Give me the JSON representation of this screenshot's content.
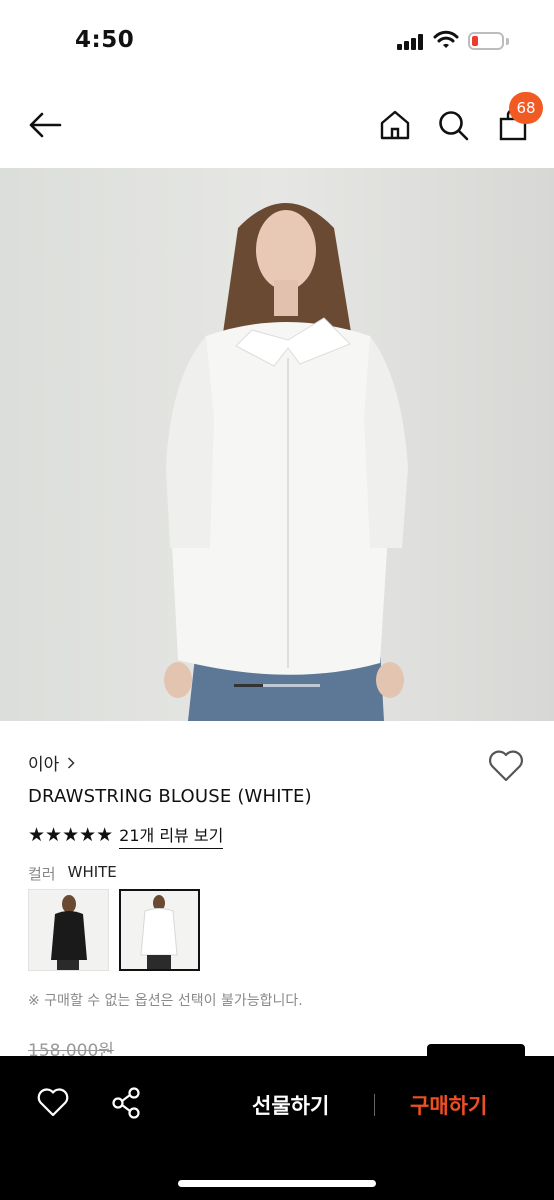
{
  "status": {
    "time": "4:50"
  },
  "nav": {
    "cart_count": "68"
  },
  "product": {
    "brand": "이아",
    "name": "DRAWSTRING BLOUSE (WHITE)",
    "rating_stars": "★★★★★",
    "review_link": "21개 리뷰 보기",
    "color_label": "컬러",
    "color_value": "WHITE",
    "notice": "※ 구매할 수 없는 옵션은 선택이 불가능합니다.",
    "original_price": "158,000원",
    "image_index": 1,
    "image_count": 3
  },
  "bottom": {
    "gift_label": "선물하기",
    "buy_label": "구매하기"
  },
  "colors": {
    "accent": "#F25A24",
    "buy": "#F04E23",
    "bar": "#000000"
  }
}
